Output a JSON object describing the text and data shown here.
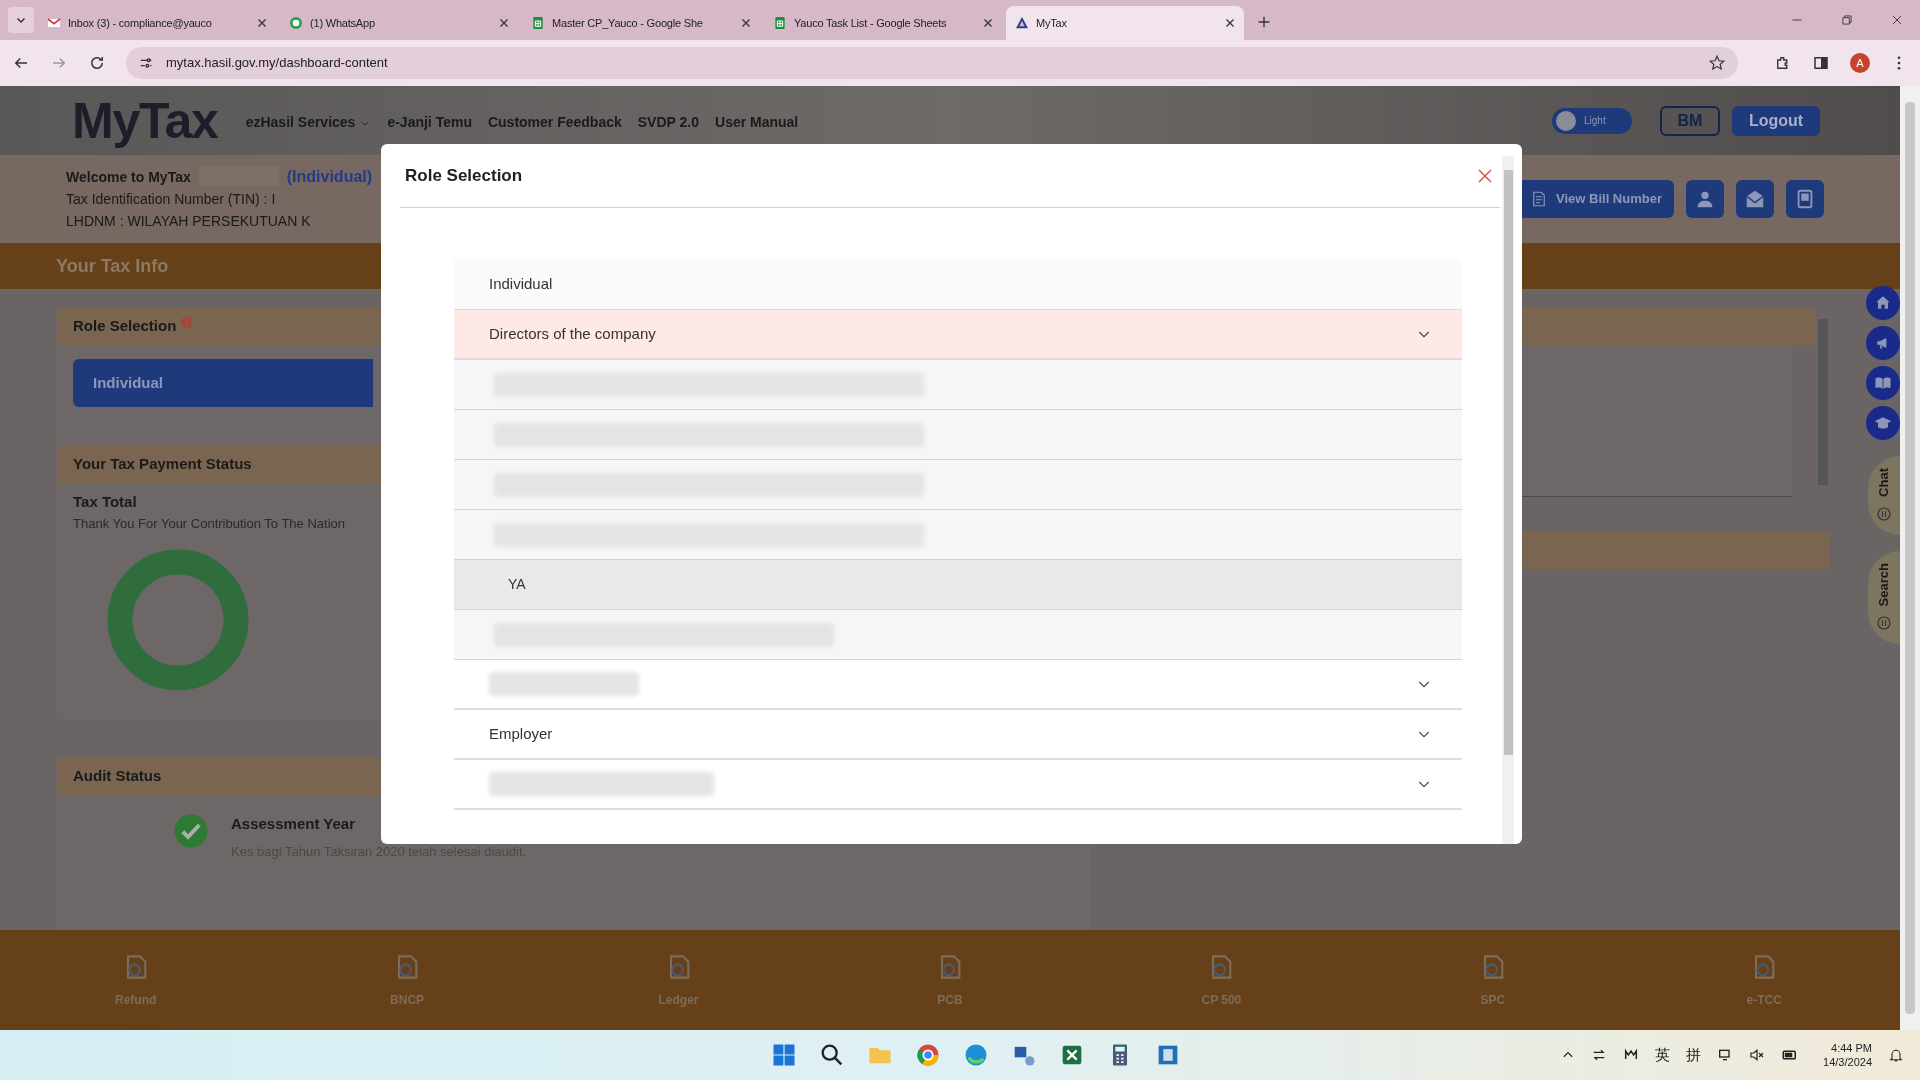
{
  "browser": {
    "tabs": [
      {
        "title": "Inbox (3) - compliance@yauco",
        "kind": "mail",
        "selected": false
      },
      {
        "title": "(1) WhatsApp",
        "kind": "chat",
        "selected": false
      },
      {
        "title": "Master CP_Yauco - Google She",
        "kind": "sheet",
        "selected": false
      },
      {
        "title": "Yauco Task List - Google Sheets",
        "kind": "sheet",
        "selected": false
      },
      {
        "title": "MyTax",
        "kind": "mytax",
        "selected": true
      }
    ],
    "url": "mytax.hasil.gov.my/dashboard-content",
    "profile_initial": "A"
  },
  "header": {
    "logo": "MyTax",
    "nav": [
      {
        "label": "ezHasil Services",
        "dropdown": true
      },
      {
        "label": "e-Janji Temu",
        "dropdown": false
      },
      {
        "label": "Customer Feedback",
        "dropdown": false
      },
      {
        "label": "SVDP 2.0",
        "dropdown": false
      },
      {
        "label": "User Manual",
        "dropdown": false
      }
    ],
    "theme_toggle": {
      "label": "Light",
      "on": false
    },
    "language_button": "BM",
    "logout_button": "Logout"
  },
  "welcome": {
    "greeting": "Welcome to MyTax",
    "role": "(Individual)",
    "tin": "Tax Identification Number (TIN) : I",
    "office": "LHDNM : WILAYAH PERSEKUTUAN K",
    "bill_button": "View Bill Number"
  },
  "tax_info_title": "Your Tax Info",
  "role_panel": {
    "title": "Role Selection",
    "selected_role": "Individual"
  },
  "payment_panel": {
    "title": "Your Tax Payment Status",
    "subtitle": "Tax Total",
    "message": "Thank You For Your Contribution To The Nation"
  },
  "audit_panel": {
    "title": "Audit Status",
    "heading": "Assessment Year",
    "detail": "Kes bagi Tahun Taksiran 2020 telah selesai diaudit."
  },
  "side_tabs": [
    "Chat",
    "Search"
  ],
  "shortcuts": [
    "Refund",
    "BNCP",
    "Ledger",
    "PCB",
    "CP 500",
    "SPC",
    "e-TCC"
  ],
  "modal": {
    "title": "Role Selection",
    "items": [
      {
        "kind": "plain",
        "label": "Individual"
      },
      {
        "kind": "group",
        "label": "Directors of the company",
        "expanded": true,
        "children": [
          {
            "kind": "redacted",
            "selected": false
          },
          {
            "kind": "redacted",
            "selected": false
          },
          {
            "kind": "redacted",
            "selected": false
          },
          {
            "kind": "redacted",
            "selected": false
          },
          {
            "kind": "text",
            "label": "YA",
            "selected": true
          },
          {
            "kind": "redacted",
            "selected": false
          }
        ]
      },
      {
        "kind": "redacted-group",
        "expanded": false
      },
      {
        "kind": "group",
        "label": "Employer",
        "expanded": false
      },
      {
        "kind": "redacted-group",
        "expanded": false
      }
    ]
  },
  "taskbar": {
    "tray": [
      "英",
      "拼"
    ],
    "time": "4:44 PM",
    "date": "14/3/2024"
  }
}
